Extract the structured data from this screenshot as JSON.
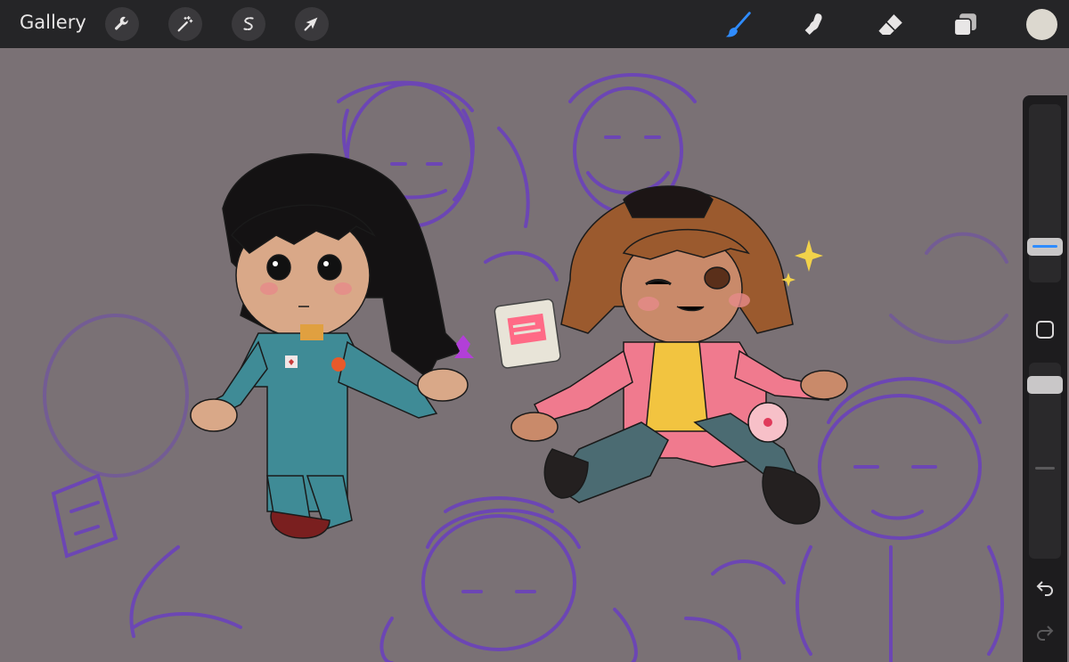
{
  "topbar": {
    "gallery_label": "Gallery",
    "left_tools": [
      {
        "name": "actions",
        "icon": "wrench-icon"
      },
      {
        "name": "adjustments",
        "icon": "magic-wand-icon"
      },
      {
        "name": "selection",
        "icon": "selection-s-icon"
      },
      {
        "name": "transform",
        "icon": "arrow-cursor-icon"
      }
    ],
    "right_tools": [
      {
        "name": "brush",
        "icon": "brush-icon",
        "active": true
      },
      {
        "name": "smudge",
        "icon": "smudge-finger-icon"
      },
      {
        "name": "eraser",
        "icon": "eraser-icon"
      },
      {
        "name": "layers",
        "icon": "layers-icon"
      }
    ],
    "current_color": "#dcd8cf"
  },
  "colors": {
    "accent": "#2f8cff",
    "canvas_bg": "#7a7175",
    "sketch_lines": "#6a3fbf"
  },
  "sidebar": {
    "tools": [
      "brush-size-slider",
      "modify-button",
      "opacity-slider",
      "undo-icon",
      "redo-icon"
    ]
  }
}
